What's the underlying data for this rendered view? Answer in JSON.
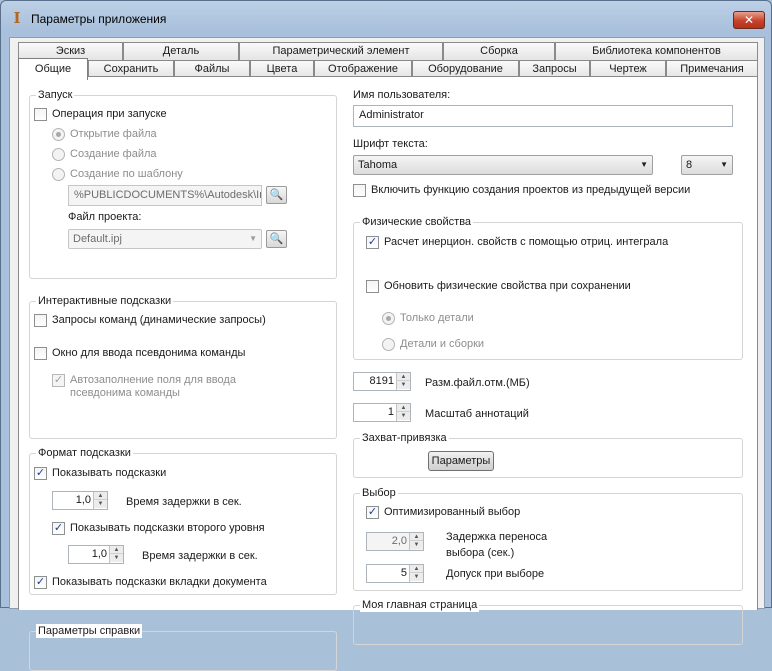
{
  "window": {
    "title": "Параметры приложения",
    "close_label": "✕"
  },
  "tabs_row1": [
    "Эскиз",
    "Деталь",
    "Параметрический элемент",
    "Сборка",
    "Библиотека компонентов"
  ],
  "tabs_row2": [
    "Общие",
    "Сохранить",
    "Файлы",
    "Цвета",
    "Отображение",
    "Оборудование",
    "Запросы",
    "Чертеж",
    "Примечания"
  ],
  "active_tab": "Общие",
  "startup": {
    "title": "Запуск",
    "on_startup": {
      "label": "Операция при запуске",
      "checked": false
    },
    "radio_open": "Открытие файла",
    "radio_new": "Создание файла",
    "radio_template": "Создание по шаблону",
    "template_path": "%PUBLICDOCUMENTS%\\Autodesk\\Inv",
    "project_label": "Файл проекта:",
    "project_value": "Default.ipj"
  },
  "hints": {
    "title": "Интерактивные подсказки",
    "command_prompts": "Запросы команд (динамические запросы)",
    "alias_window": "Окно для ввода псевдонима команды",
    "autocomplete": "Автозаполнение поля для ввода псевдонима команды",
    "autocomplete_checked": true
  },
  "tooltip": {
    "title": "Формат подсказки",
    "show_tooltips": "Показывать подсказки",
    "delay1_value": "1,0",
    "delay1_label": "Время задержки в сек.",
    "show_second": "Показывать подсказки второго уровня",
    "delay2_value": "1,0",
    "delay2_label": "Время задержки в сек.",
    "doc_tab_tooltips": "Показывать подсказки вкладки документа"
  },
  "help": {
    "title": "Параметры справки"
  },
  "user": {
    "label": "Имя пользователя:",
    "value": "Administrator"
  },
  "font": {
    "label": "Шрифт текста:",
    "value": "Tahoma",
    "size": "8"
  },
  "legacy_projects": "Включить функцию создания проектов из предыдущей версии",
  "physical": {
    "title": "Физические свойства",
    "negative_integral": "Расчет инерцион. свойств с помощью отриц. интеграла",
    "update_on_save": "Обновить физические свойства при сохранении",
    "parts_only": "Только детали",
    "parts_assemblies": "Детали и сборки"
  },
  "undo_file": {
    "value": "8191",
    "label": "Разм.файл.отм.(МБ)"
  },
  "annotation_scale": {
    "value": "1",
    "label": "Масштаб аннотаций"
  },
  "snap": {
    "title": "Захват-привязка",
    "button": "Параметры"
  },
  "selection": {
    "title": "Выбор",
    "optimized": "Оптимизированный выбор",
    "transfer_delay_value": "2,0",
    "transfer_delay_label_line1": "Задержка переноса",
    "transfer_delay_label_line2": "выбора (сек.)",
    "tolerance_value": "5",
    "tolerance_label": "Допуск при выборе"
  },
  "home": {
    "title": "Моя главная страница"
  },
  "icons": {
    "app": "inventor-app-icon",
    "browse": "browse-folder-icon",
    "check": "✓",
    "arrow": "▼"
  }
}
